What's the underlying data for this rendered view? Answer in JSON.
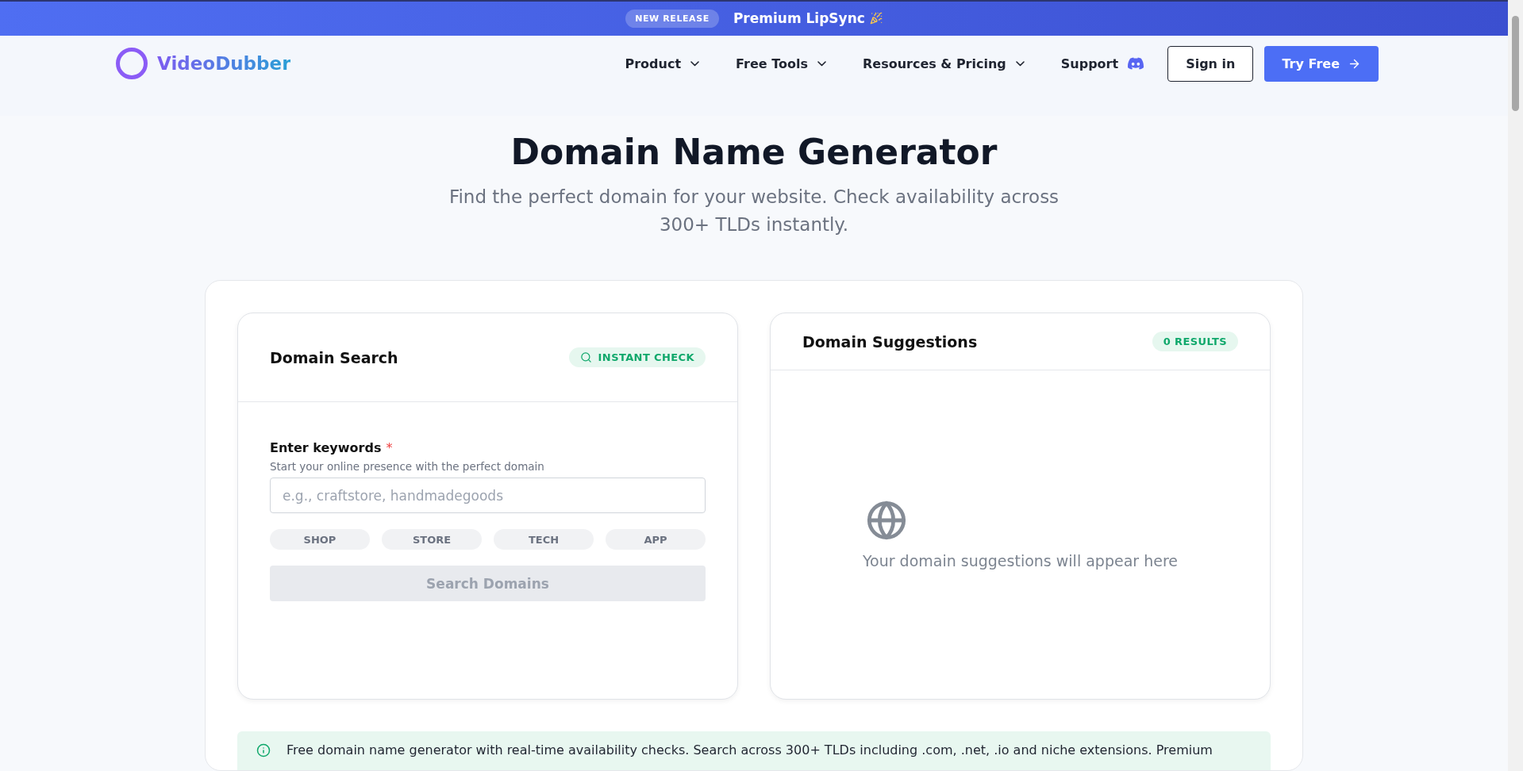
{
  "banner": {
    "badge": "NEW RELEASE",
    "text": "Premium LipSync"
  },
  "nav": {
    "logo": "VideoDubber",
    "items": [
      {
        "label": "Product",
        "kind": "dropdown"
      },
      {
        "label": "Free Tools",
        "kind": "dropdown"
      },
      {
        "label": "Resources & Pricing",
        "kind": "dropdown"
      },
      {
        "label": "Support",
        "kind": "discord"
      }
    ],
    "sign_in": "Sign in",
    "try_free": "Try Free"
  },
  "hero": {
    "title": "Domain Name Generator",
    "subtitle": "Find the perfect domain for your website. Check availability across 300+ TLDs instantly."
  },
  "search_panel": {
    "title": "Domain Search",
    "badge": "INSTANT CHECK",
    "label": "Enter keywords",
    "required_mark": "*",
    "hint": "Start your online presence with the perfect domain",
    "placeholder": "e.g., craftstore, handmadegoods",
    "chips": [
      "SHOP",
      "STORE",
      "TECH",
      "APP"
    ],
    "button": {
      "label": "Search Domains",
      "disabled": true
    }
  },
  "suggestions_panel": {
    "title": "Domain Suggestions",
    "badge": "0 RESULTS",
    "empty_text": "Your domain suggestions will appear here"
  },
  "info": {
    "text": "Free domain name generator with real-time availability checks. Search across 300+ TLDs including .com, .net, .io and niche extensions. Premium"
  }
}
